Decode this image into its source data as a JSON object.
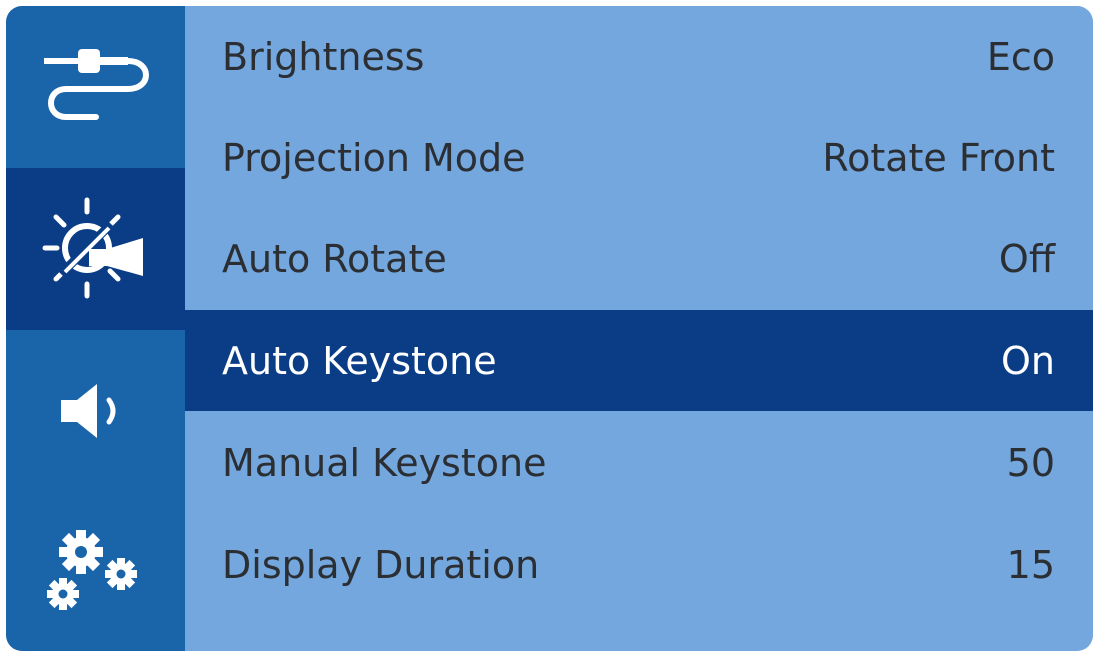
{
  "colors": {
    "sidebar": "#1a64aa",
    "sidebar_active": "#0a3d85",
    "content": "#73a7dd",
    "selected_row": "#0a3d85",
    "text": "#2b2e33",
    "selected_text": "#ffffff"
  },
  "sidebar": {
    "items": [
      {
        "icon": "source-cable-icon"
      },
      {
        "icon": "brightness-projection-icon",
        "active": true
      },
      {
        "icon": "speaker-icon"
      },
      {
        "icon": "gears-icon"
      }
    ]
  },
  "menu": {
    "rows": [
      {
        "label": "Brightness",
        "value": "Eco"
      },
      {
        "label": "Projection Mode",
        "value": "Rotate Front"
      },
      {
        "label": "Auto Rotate",
        "value": "Off"
      },
      {
        "label": "Auto Keystone",
        "value": "On",
        "selected": true
      },
      {
        "label": "Manual Keystone",
        "value": "50"
      },
      {
        "label": "Display Duration",
        "value": "15"
      }
    ]
  }
}
